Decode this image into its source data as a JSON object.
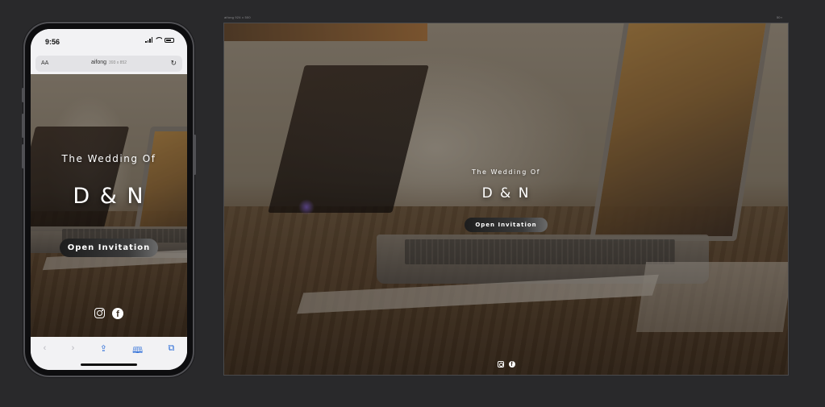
{
  "phone": {
    "status_time": "9:56",
    "url_aa": "AA",
    "url_domain": "aifong",
    "url_size": "393 x 852",
    "reload_icon": "reload-icon",
    "toolbar_icons": [
      "back-icon",
      "forward-icon",
      "share-icon",
      "bookmarks-icon",
      "tabs-icon"
    ]
  },
  "desktop": {
    "label_left": "aifong   924 x 500",
    "label_right": "50 ▪"
  },
  "invitation": {
    "subtitle": "The Wedding Of",
    "names": "D & N",
    "open_button": "Open Invitation",
    "social_icons": [
      "instagram-icon",
      "facebook-icon"
    ],
    "facebook_glyph": "f"
  },
  "colors": {
    "page_background": "#29292b",
    "safari_accent": "#2f6fd8",
    "button_dark": "#1d1d1d"
  }
}
